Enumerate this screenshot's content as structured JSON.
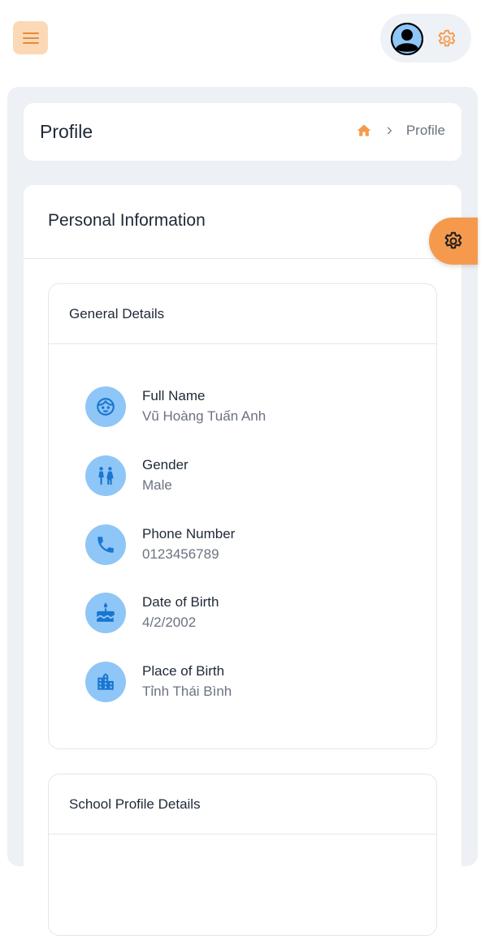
{
  "header": {
    "menu_icon": "hamburger-icon",
    "avatar_icon": "user-avatar-icon",
    "settings_icon": "gear-icon"
  },
  "page": {
    "title": "Profile",
    "breadcrumb": {
      "home_icon": "home-icon",
      "separator_icon": "chevron-right-icon",
      "current": "Profile"
    }
  },
  "personal_info": {
    "title": "Personal Information",
    "floating_settings_icon": "gear-icon",
    "general_details": {
      "title": "General Details",
      "items": [
        {
          "icon": "face-icon",
          "label": "Full Name",
          "value": "Vũ Hoàng Tuấn Anh"
        },
        {
          "icon": "people-icon",
          "label": "Gender",
          "value": "Male"
        },
        {
          "icon": "phone-icon",
          "label": "Phone Number",
          "value": "0123456789"
        },
        {
          "icon": "cake-icon",
          "label": "Date of Birth",
          "value": "4/2/2002"
        },
        {
          "icon": "city-icon",
          "label": "Place of Birth",
          "value": "Tỉnh Thái Bình"
        }
      ]
    },
    "school_profile": {
      "title": "School Profile Details"
    }
  },
  "colors": {
    "accent": "#f59a4d",
    "accent_light": "#fcd9b6",
    "icon_bg": "#8ec6f7",
    "icon_fg": "#1976d2",
    "page_bg": "#edf0f5"
  }
}
